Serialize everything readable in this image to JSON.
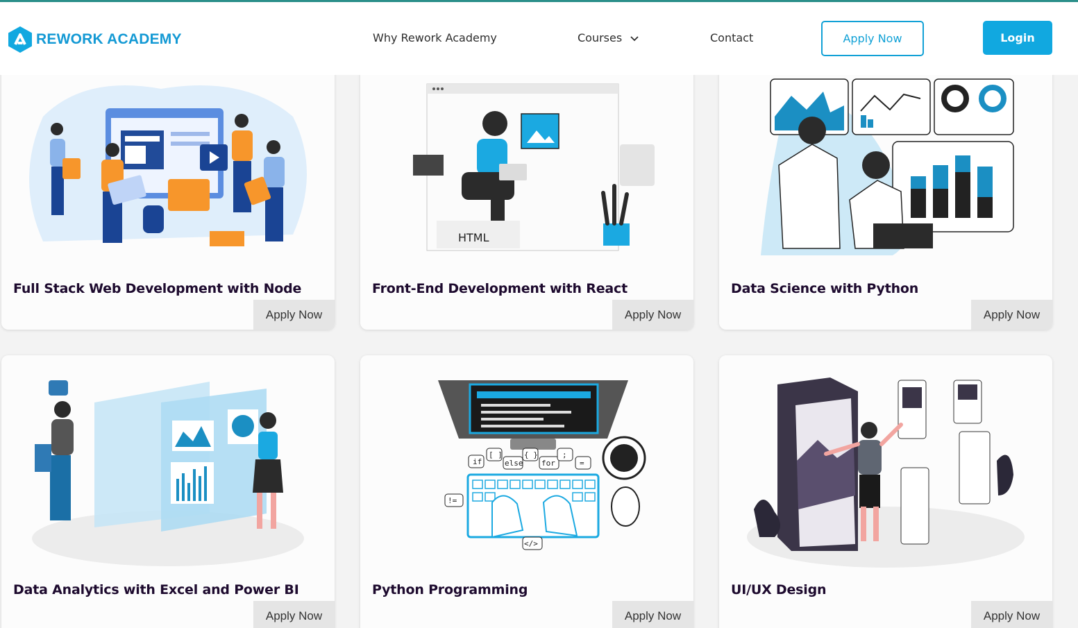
{
  "brand": {
    "name": "REWORK ACADEMY",
    "accent": "#11a8e0",
    "title_color": "#1d0a2e"
  },
  "nav": {
    "why": "Why Rework Academy",
    "courses": "Courses",
    "contact": "Contact",
    "apply_now": "Apply Now",
    "login": "Login"
  },
  "courses": [
    {
      "title": "Full Stack Web Development with Node",
      "apply": "Apply Now",
      "illustration": "team-web-development-illustration"
    },
    {
      "title": "Front-End Development with React",
      "apply": "Apply Now",
      "illustration": "html-developer-illustration",
      "html_label": "HTML"
    },
    {
      "title": "Data Science with Python",
      "apply": "Apply Now",
      "illustration": "data-scientists-dashboard-illustration"
    },
    {
      "title": "Data Analytics with Excel and Power BI",
      "apply": "Apply Now",
      "illustration": "analytics-screens-illustration"
    },
    {
      "title": "Python Programming",
      "apply": "Apply Now",
      "illustration": "coding-keyboard-illustration",
      "keywords": [
        "if",
        "[ ]",
        "else",
        "{ }",
        "for",
        ";",
        "=",
        "!=",
        "</>"
      ]
    },
    {
      "title": "UI/UX Design",
      "apply": "Apply Now",
      "illustration": "mobile-ui-design-illustration"
    }
  ]
}
